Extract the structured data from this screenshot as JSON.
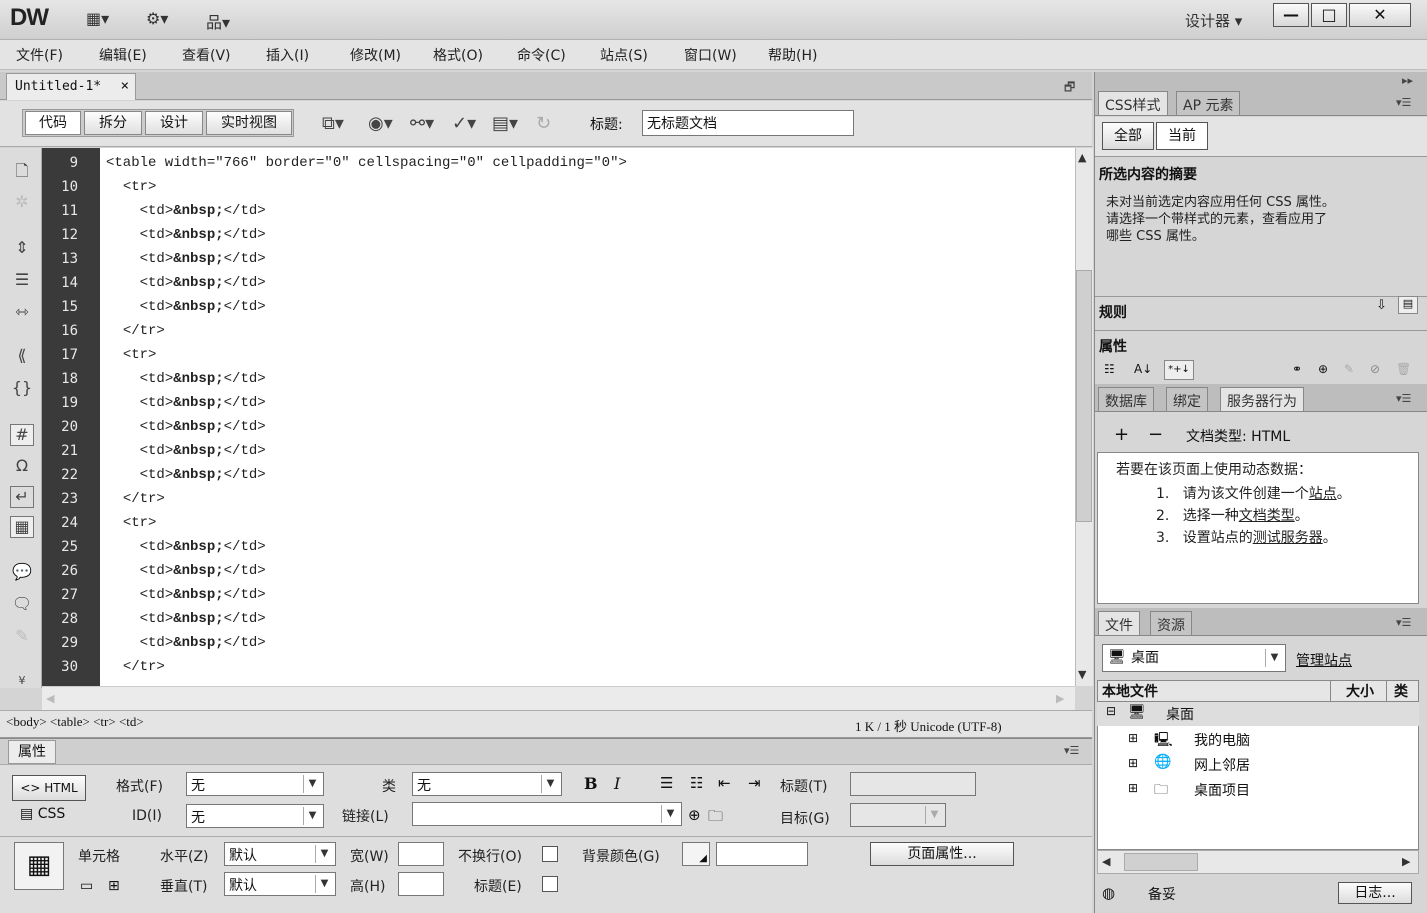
{
  "app": {
    "logo": "DW",
    "workspace": "设计器 ▾"
  },
  "window_controls": {
    "minimize": "—",
    "maximize": "□",
    "close": "✕"
  },
  "titlebar_icons": [
    "layout-icon",
    "gear-icon",
    "site-icon"
  ],
  "menu": [
    "文件(F)",
    "编辑(E)",
    "查看(V)",
    "插入(I)",
    "修改(M)",
    "格式(O)",
    "命令(C)",
    "站点(S)",
    "窗口(W)",
    "帮助(H)"
  ],
  "document": {
    "tab_name": "Untitled-1*",
    "tab_close": "×",
    "views": [
      "代码",
      "拆分",
      "设计",
      "实时视图"
    ],
    "title_label": "标题:",
    "title_value": "无标题文档"
  },
  "code": {
    "line_numbers": [
      "9",
      "10",
      "11",
      "12",
      "13",
      "14",
      "15",
      "16",
      "17",
      "18",
      "19",
      "20",
      "21",
      "22",
      "23",
      "24",
      "25",
      "26",
      "27",
      "28",
      "29",
      "30"
    ],
    "table_open": "<table width=\"766\" border=\"0\" cellspacing=\"0\" cellpadding=\"0\">",
    "tr_open": "<tr>",
    "tr_close": "</tr>",
    "td_open": "<td>",
    "nbsp": "&nbsp;",
    "td_close": "</td>"
  },
  "status": {
    "tag_selector": "<body> <table> <tr> <td>",
    "doc_info": "1 K / 1 秒  Unicode (UTF-8)"
  },
  "properties": {
    "tab": "属性",
    "html_btn": "<> HTML",
    "css_btn": "CSS",
    "format_label": "格式(F)",
    "format_value": "无",
    "id_label": "ID(I)",
    "id_value": "无",
    "class_label": "类",
    "class_value": "无",
    "link_label": "链接(L)",
    "bold": "B",
    "italic": "I",
    "title_label": "标题(T)",
    "target_label": "目标(G)",
    "cell_label": "单元格",
    "horiz_label": "水平(Z)",
    "horiz_value": "默认",
    "vert_label": "垂直(T)",
    "vert_value": "默认",
    "width_label": "宽(W)",
    "height_label": "高(H)",
    "nowrap_label": "不换行(O)",
    "header_label": "标题(E)",
    "bg_label": "背景颜色(G)",
    "page_props_btn": "页面属性..."
  },
  "css_panel": {
    "tabs": [
      "CSS样式",
      "AP 元素"
    ],
    "mode_buttons": [
      "全部",
      "当前"
    ],
    "summary_title": "所选内容的摘要",
    "summary_text_1": "未对当前选定内容应用任何 CSS 属性。",
    "summary_text_2": "请选择一个带样式的元素，查看应用了",
    "summary_text_3": "哪些 CSS 属性。",
    "rules_title": "规则",
    "properties_title": "属性"
  },
  "server_panel": {
    "tabs": [
      "数据库",
      "绑定",
      "服务器行为"
    ],
    "plus": "+",
    "minus": "−",
    "doc_type": "文档类型: HTML",
    "intro": "若要在该页面上使用动态数据：",
    "steps": [
      {
        "num": "1.",
        "pre": "请为该文件创建一个",
        "link": "站点",
        "post": "。"
      },
      {
        "num": "2.",
        "pre": "选择一种",
        "link": "文档类型",
        "post": "。"
      },
      {
        "num": "3.",
        "pre": "设置站点的",
        "link": "测试服务器",
        "post": "。"
      }
    ]
  },
  "files_panel": {
    "tabs": [
      "文件",
      "资源"
    ],
    "location": "桌面",
    "manage_sites": "管理站点",
    "col_local": "本地文件",
    "col_size": "大小",
    "col_type": "类",
    "root": "桌面",
    "items": [
      "我的电脑",
      "网上邻居",
      "桌面项目"
    ],
    "status": "备妥",
    "log_btn": "日志..."
  }
}
